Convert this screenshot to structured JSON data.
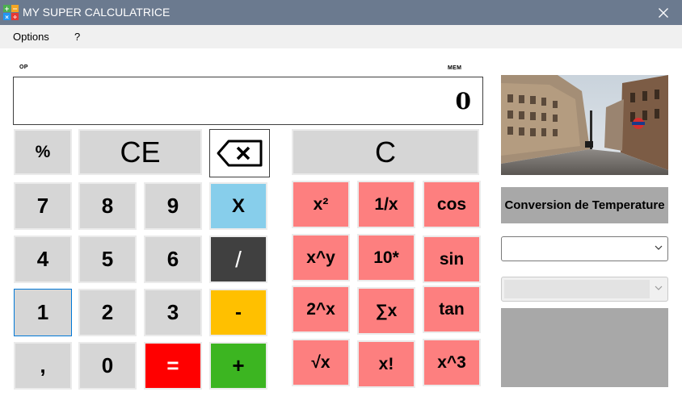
{
  "window": {
    "title": "MY SUPER CALCULATRICE"
  },
  "menu": {
    "options": "Options",
    "help": "?"
  },
  "calculator": {
    "op_label": "OP",
    "mem_label": "MEM",
    "display_value": "0",
    "buttons": {
      "percent": "%",
      "ce": "CE",
      "clear": "C",
      "seven": "7",
      "eight": "8",
      "nine": "9",
      "multiply": "X",
      "four": "4",
      "five": "5",
      "six": "6",
      "divide": "/",
      "one": "1",
      "two": "2",
      "three": "3",
      "minus": "-",
      "comma": ",",
      "zero": "0",
      "equals": "=",
      "plus": "+",
      "square": "x²",
      "inverse": "1/x",
      "cos": "cos",
      "power": "x^y",
      "pow10": "10*",
      "sin": "sin",
      "pow2": "2^x",
      "sum": "∑x",
      "tan": "tan",
      "sqrt": "√x",
      "factorial": "x!",
      "cube": "x^3"
    }
  },
  "conversion": {
    "title": "Conversion de Temperature",
    "select1_value": "",
    "select2_value": ""
  },
  "colors": {
    "titlebar": "#6b7a8f",
    "gray_button": "#d6d6d6",
    "function_button": "#fd7f7f",
    "multiply": "#87ceeb",
    "divide": "#404040",
    "minus": "#ffc000",
    "equals": "#ff0000",
    "plus": "#3cb521",
    "panel": "#a8a8a8"
  },
  "icons": {
    "app": "calculator-app-icon",
    "close": "close-icon",
    "backspace": "backspace-icon",
    "dropdown": "chevron-down-icon"
  }
}
